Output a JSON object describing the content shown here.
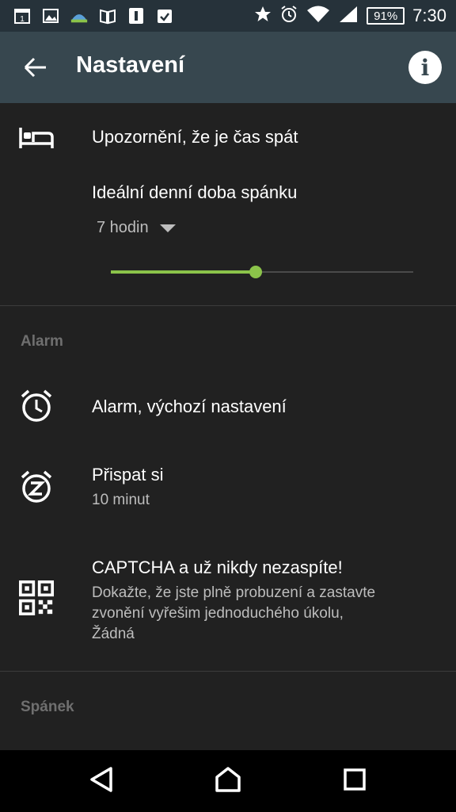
{
  "status_bar": {
    "battery": "91%",
    "time": "7:30",
    "notification_icons": [
      "calendar-icon",
      "image-icon",
      "weather-icon",
      "book-icon",
      "app-icon",
      "checkbox-icon"
    ],
    "system_icons": [
      "star-icon",
      "alarm-icon",
      "wifi-icon",
      "signal-icon"
    ]
  },
  "app_bar": {
    "title": "Nastavení",
    "back_icon": "arrow-left-icon",
    "info_icon": "info-icon",
    "info_glyph": "i"
  },
  "sleep_reminder": {
    "title": "Upozornění, že je čas spát",
    "icon": "bed-icon"
  },
  "ideal_sleep": {
    "title": "Ideální denní doba spánku",
    "selected": "7 hodin",
    "slider_fraction": 0.48,
    "accent": "#8bc34a"
  },
  "sections": {
    "alarm": "Alarm",
    "sleep": "Spánek"
  },
  "alarm_defaults": {
    "title": "Alarm, výchozí nastavení",
    "icon": "alarm-clock-icon"
  },
  "snooze": {
    "title": "Přispat si",
    "subtitle": "10 minut",
    "icon": "snooze-icon"
  },
  "captcha": {
    "title": "CAPTCHA a už nikdy nezaspíte!",
    "subtitle_line1": "Dokažte, že jste plně probuzení a zastavte",
    "subtitle_line2": "zvonění vyřešim jednoduchého úkolu,",
    "subtitle_line3": "Žádná",
    "icon": "qr-code-icon"
  },
  "nav_bar": {
    "back": "back-triangle-icon",
    "home": "home-icon",
    "recents": "recents-square-icon"
  },
  "colors": {
    "background": "#212121",
    "app_bar": "#37474f",
    "status_bar": "#26323a"
  }
}
